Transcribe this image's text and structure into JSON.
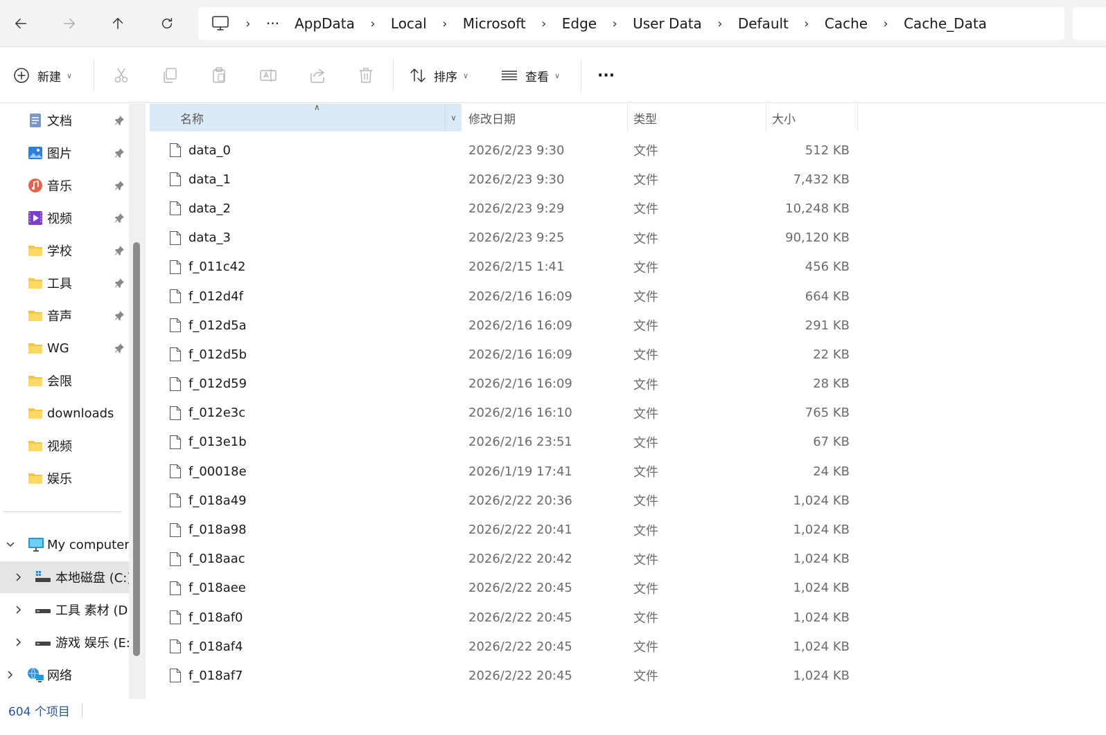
{
  "breadcrumb": {
    "overflow_label": "···",
    "items": [
      "AppData",
      "Local",
      "Microsoft",
      "Edge",
      "User Data",
      "Default",
      "Cache",
      "Cache_Data"
    ]
  },
  "toolbar": {
    "new_label": "新建",
    "sort_label": "排序",
    "view_label": "查看",
    "more_label": "···"
  },
  "sidebar": {
    "quick_access": [
      {
        "label": "文档",
        "icon": "documents-icon",
        "pinned": true
      },
      {
        "label": "图片",
        "icon": "pictures-icon",
        "pinned": true
      },
      {
        "label": "音乐",
        "icon": "music-icon",
        "pinned": true
      },
      {
        "label": "视频",
        "icon": "videos-icon",
        "pinned": true
      },
      {
        "label": "学校",
        "icon": "folder-icon",
        "pinned": true
      },
      {
        "label": "工具",
        "icon": "folder-icon",
        "pinned": true
      },
      {
        "label": "音声",
        "icon": "folder-icon",
        "pinned": true
      },
      {
        "label": "WG",
        "icon": "folder-icon",
        "pinned": true
      },
      {
        "label": "会限",
        "icon": "folder-icon",
        "pinned": false
      },
      {
        "label": "downloads",
        "icon": "folder-icon",
        "pinned": false
      },
      {
        "label": "视频",
        "icon": "folder-icon",
        "pinned": false
      },
      {
        "label": "娱乐",
        "icon": "folder-icon",
        "pinned": false
      }
    ],
    "my_computer": "My computer",
    "drives": [
      {
        "label": "本地磁盘 (C:)",
        "selected": true
      },
      {
        "label": "工具 素材 (D:",
        "selected": false
      },
      {
        "label": "游戏 娱乐 (E:)",
        "selected": false
      }
    ],
    "network": "网络"
  },
  "columns": {
    "name": "名称",
    "date": "修改日期",
    "type": "类型",
    "size": "大小"
  },
  "files": [
    {
      "name": "data_0",
      "date": "2026/2/23 9:30",
      "type": "文件",
      "size": "512 KB"
    },
    {
      "name": "data_1",
      "date": "2026/2/23 9:30",
      "type": "文件",
      "size": "7,432 KB"
    },
    {
      "name": "data_2",
      "date": "2026/2/23 9:29",
      "type": "文件",
      "size": "10,248 KB"
    },
    {
      "name": "data_3",
      "date": "2026/2/23 9:25",
      "type": "文件",
      "size": "90,120 KB"
    },
    {
      "name": "f_011c42",
      "date": "2026/2/15 1:41",
      "type": "文件",
      "size": "456 KB"
    },
    {
      "name": "f_012d4f",
      "date": "2026/2/16 16:09",
      "type": "文件",
      "size": "664 KB"
    },
    {
      "name": "f_012d5a",
      "date": "2026/2/16 16:09",
      "type": "文件",
      "size": "291 KB"
    },
    {
      "name": "f_012d5b",
      "date": "2026/2/16 16:09",
      "type": "文件",
      "size": "22 KB"
    },
    {
      "name": "f_012d59",
      "date": "2026/2/16 16:09",
      "type": "文件",
      "size": "28 KB"
    },
    {
      "name": "f_012e3c",
      "date": "2026/2/16 16:10",
      "type": "文件",
      "size": "765 KB"
    },
    {
      "name": "f_013e1b",
      "date": "2026/2/16 23:51",
      "type": "文件",
      "size": "67 KB"
    },
    {
      "name": "f_00018e",
      "date": "2026/1/19 17:41",
      "type": "文件",
      "size": "24 KB"
    },
    {
      "name": "f_018a49",
      "date": "2026/2/22 20:36",
      "type": "文件",
      "size": "1,024 KB"
    },
    {
      "name": "f_018a98",
      "date": "2026/2/22 20:41",
      "type": "文件",
      "size": "1,024 KB"
    },
    {
      "name": "f_018aac",
      "date": "2026/2/22 20:42",
      "type": "文件",
      "size": "1,024 KB"
    },
    {
      "name": "f_018aee",
      "date": "2026/2/22 20:45",
      "type": "文件",
      "size": "1,024 KB"
    },
    {
      "name": "f_018af0",
      "date": "2026/2/22 20:45",
      "type": "文件",
      "size": "1,024 KB"
    },
    {
      "name": "f_018af4",
      "date": "2026/2/22 20:45",
      "type": "文件",
      "size": "1,024 KB"
    },
    {
      "name": "f_018af7",
      "date": "2026/2/22 20:45",
      "type": "文件",
      "size": "1,024 KB"
    }
  ],
  "status": {
    "item_count": "604 个项目"
  },
  "colors": {
    "header_selected": "#dbeaf7",
    "sidebar_selected": "#e5e5e5",
    "folder_yellow": "#f5c542",
    "status_blue": "#2a5599"
  }
}
